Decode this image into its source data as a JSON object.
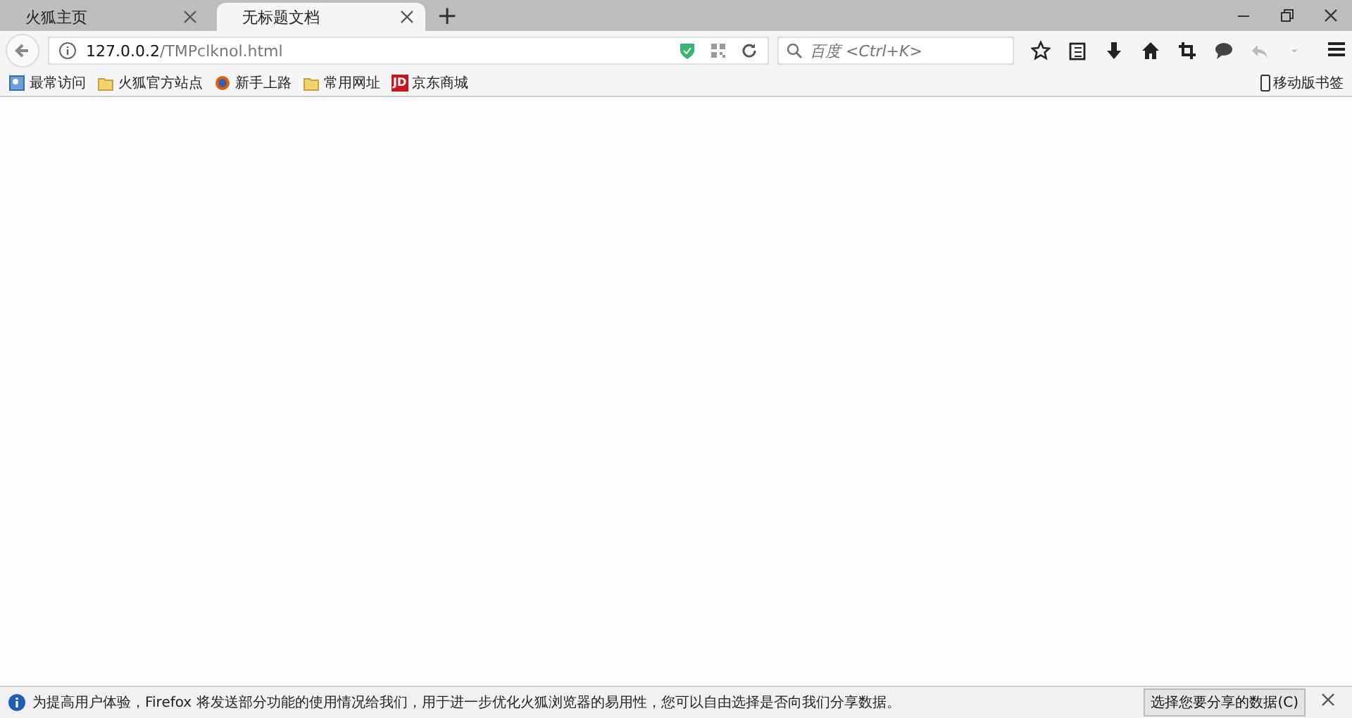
{
  "tabs": [
    {
      "title": "火狐主页",
      "selected": false
    },
    {
      "title": "无标题文档",
      "selected": true
    }
  ],
  "new_tab": "+",
  "address_bar": {
    "host": "127.0.0.2",
    "path": "/TMPclknol.html"
  },
  "search": {
    "placeholder": "百度 <Ctrl+K>"
  },
  "bookmarks": [
    {
      "label": "最常访问",
      "kind": "smart"
    },
    {
      "label": "火狐官方站点",
      "kind": "folder"
    },
    {
      "label": "新手上路",
      "kind": "firefox"
    },
    {
      "label": "常用网址",
      "kind": "folder"
    },
    {
      "label": "京东商城",
      "kind": "jd",
      "badge": "JD"
    }
  ],
  "mobile_bookmarks": "移动版书签",
  "notification": {
    "message": "为提高用户体验，Firefox 将发送部分功能的使用情况给我们，用于进一步优化火狐浏览器的易用性，您可以自由选择是否向我们分享数据。",
    "button": "选择您要分享的数据(C)"
  }
}
